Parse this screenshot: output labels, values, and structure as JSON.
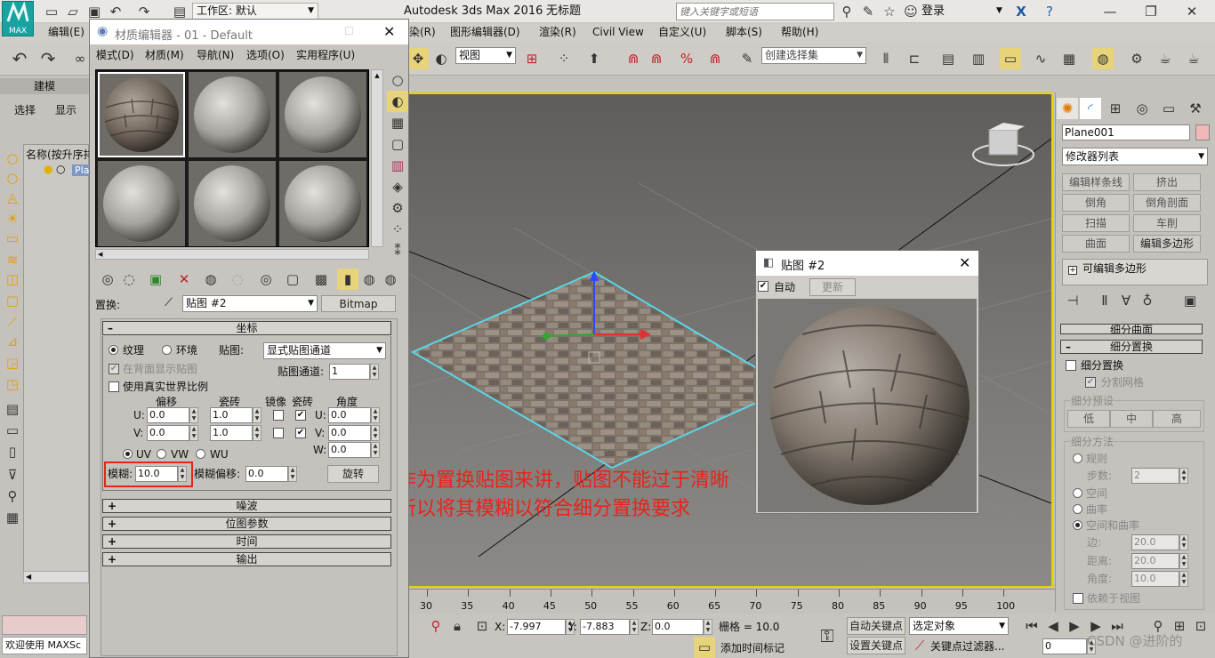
{
  "app": {
    "title": "Autodesk 3ds Max 2016",
    "doc_title": "无标题",
    "logo_text": "MAX",
    "workspace": "工作区: 默认",
    "search_placeholder": "键入关键字或短语",
    "login": "登录"
  },
  "main_menu": [
    "编辑(E)",
    "染(R)",
    "图形编辑器(D)",
    "渲染(R)",
    "Civil View",
    "自定义(U)",
    "脚本(S)",
    "帮助(H)"
  ],
  "main_toolbar": {
    "view_dropdown": "视图",
    "selection_set_placeholder": "创建选择集"
  },
  "left_panel": {
    "tab": "建模",
    "select_label": "选择",
    "display_label": "显示",
    "list_header": "名称(按升序排",
    "object_name": "Plan"
  },
  "status": {
    "welcome": "欢迎使用 MAXSc"
  },
  "material_editor": {
    "title": "材质编辑器 - 01 - Default",
    "menu": [
      "模式(D)",
      "材质(M)",
      "导航(N)",
      "选项(O)",
      "实用程序(U)"
    ],
    "replace_label": "置换:",
    "map_name": "贴图 #2",
    "map_type": "Bitmap",
    "rollouts": {
      "coordinates": "坐标",
      "noise": "噪波",
      "bitmap_params": "位图参数",
      "time": "时间",
      "output": "输出"
    },
    "coords": {
      "texture": "纹理",
      "environ": "环境",
      "mapping_label": "贴图:",
      "mapping_value": "显式贴图通道",
      "show_map_on_back": "在背面显示贴图",
      "map_channel_label": "贴图通道:",
      "map_channel_value": "1",
      "use_real_world": "使用真实世界比例",
      "offset_header": "偏移",
      "tiling_header": "瓷砖",
      "mirror_header": "镜像",
      "tile_header": "瓷砖",
      "angle_header": "角度",
      "u_label": "U:",
      "v_label": "V:",
      "w_label": "W:",
      "u_offset": "0.0",
      "v_offset": "0.0",
      "u_tiling": "1.0",
      "v_tiling": "1.0",
      "u_angle": "0.0",
      "v_angle": "0.0",
      "w_angle": "0.0",
      "uv": "UV",
      "vw": "VW",
      "wu": "WU",
      "blur_label": "模糊:",
      "blur_value": "10.0",
      "blur_offset_label": "模糊偏移:",
      "blur_offset_value": "0.0",
      "rotate_btn": "旋转"
    }
  },
  "annotation": {
    "line1": "作为置换贴图来讲，贴图不能过于清晰",
    "line2": "所以将其模糊以符合细分置换要求",
    "color": "#e8231c"
  },
  "map_preview": {
    "title": "贴图 #2",
    "auto_label": "自动",
    "update_label": "更新"
  },
  "right_panel": {
    "object_name": "Plane001",
    "modifier_list": "修改器列表",
    "buttons": [
      "编辑样条线",
      "挤出",
      "倒角",
      "倒角剖面",
      "扫描",
      "车削",
      "曲面",
      "编辑多边形"
    ],
    "stack_item": "可编辑多边形",
    "partial_rollout": "细分曲面",
    "subdiv_rollout": "细分置换",
    "subdiv_disp": "细分置换",
    "split_mesh": "分割网格",
    "presets_label": "细分预设",
    "low": "低",
    "mid": "中",
    "high": "高",
    "method_label": "细分方法",
    "regular": "规则",
    "steps_label": "步数:",
    "steps_value": "2",
    "spatial": "空间",
    "curvature": "曲率",
    "spatial_curv": "空间和曲率",
    "edge_label": "边:",
    "edge_value": "20.0",
    "distance_label": "距离:",
    "distance_value": "20.0",
    "angle_label": "角度:",
    "angle_value": "10.0",
    "view_dependent": "依赖于视图"
  },
  "timeline": {
    "ticks": [
      "30",
      "35",
      "40",
      "45",
      "50",
      "55",
      "60",
      "65",
      "70",
      "75",
      "80",
      "85",
      "90",
      "95",
      "100"
    ]
  },
  "bottom_bar": {
    "x_label": "X:",
    "x_value": "-7.997",
    "y_label": "Y:",
    "y_value": "-7.883",
    "z_label": "Z:",
    "z_value": "0.0",
    "grid": "栅格 = 10.0",
    "auto_key": "自动关键点",
    "set_key": "设置关键点",
    "selected_obj": "选定对象",
    "key_filters": "关键点过滤器...",
    "add_time_tag": "添加时间标记",
    "frame_value": "0",
    "watermark": "CSDN @进阶的"
  }
}
